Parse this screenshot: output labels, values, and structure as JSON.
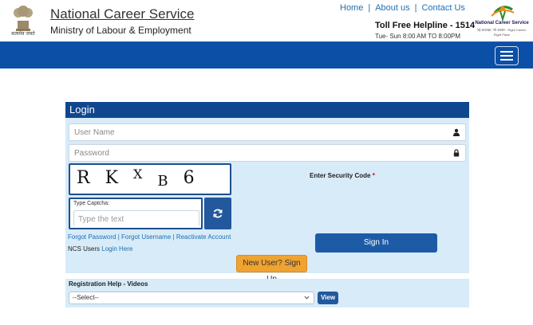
{
  "header": {
    "emblem_caption": "सत्यमेव जयते",
    "site_title": "National Career Service",
    "ministry": "Ministry of Labour & Employment",
    "nav": [
      {
        "label": "Home"
      },
      {
        "label": "About us"
      },
      {
        "label": "Contact Us"
      }
    ],
    "nav_separator": "|",
    "helpline": "Toll Free Helpline - 1514",
    "hours": "Tue- Sun 8:00 AM TO 8:00PM",
    "logo_title": "National Career Service",
    "logo_subtitle": "नई आकांक्षा, नये अवसर · Right Career, Right Place"
  },
  "colors": {
    "blue_bar": "#0b4fa6",
    "panel_bg": "#d7ebf8",
    "login_header": "#10468f",
    "accent_orange": "#f0a330"
  },
  "login": {
    "title": "Login",
    "username_placeholder": "User Name",
    "password_placeholder": "Password",
    "captcha": {
      "chars": [
        "R",
        "K",
        "X",
        "B",
        "6"
      ]
    },
    "type_captcha_label": "Type Captcha:",
    "type_captcha_placeholder": "Type the text",
    "security_code_label": "Enter Security Code",
    "required_mark": "*",
    "forgot_password": "Forgot Password",
    "forgot_username": "Forgot Username",
    "reactivate_account": "Reactivate Account",
    "link_separator": "|",
    "ncs_users_text": "NCS Users",
    "login_here": "Login Here",
    "sign_in": "Sign In",
    "sign_up": "New User? Sign Up"
  },
  "registration": {
    "title": "Registration Help - Videos",
    "selected": "--Select--",
    "view": "View"
  },
  "icons": {
    "user": "user-icon",
    "lock": "lock-icon",
    "refresh": "refresh-icon",
    "menu": "hamburger-icon",
    "chevron": "chevron-down-icon"
  }
}
